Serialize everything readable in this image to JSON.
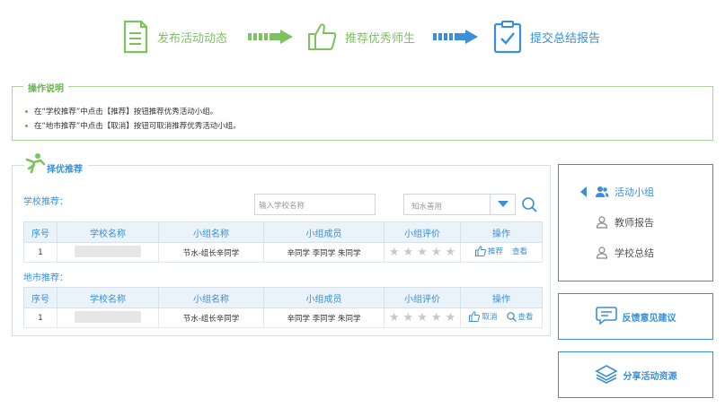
{
  "steps": [
    {
      "label": "发布活动动态",
      "icon": "document-icon"
    },
    {
      "label": "推荐优秀师生",
      "icon": "thumbs-up-icon"
    },
    {
      "label": "提交总结报告",
      "icon": "clipboard-check-icon"
    }
  ],
  "instructions": {
    "title": "操作说明",
    "items": [
      "在“学校推荐”中点击【推荐】按钮推荐优秀活动小组。",
      "在“地市推荐”中点击【取消】按钮可取消推荐优秀活动小组。"
    ]
  },
  "panel": {
    "title": "择优推荐",
    "school_section": "学校推荐：",
    "city_section": "地市推荐：",
    "search_placeholder": "输入学校名称",
    "select_value": "知水善用",
    "columns": [
      "序号",
      "学校名称",
      "小组名称",
      "小组成员",
      "小组评价",
      "操作"
    ],
    "school_rows": [
      {
        "index": "1",
        "group": "节水-组长辛同学",
        "members": "辛同学 李同学 朱同学",
        "action1": "推荐",
        "action2": "查看"
      }
    ],
    "city_rows": [
      {
        "index": "1",
        "group": "节水-组长辛同学",
        "members": "辛同学 李同学 朱同学",
        "action1": "取消",
        "action2": "查看"
      }
    ]
  },
  "sidebar": {
    "items": [
      "活动小组",
      "教师报告",
      "学校总结"
    ],
    "feedback": "反馈意见建议",
    "share": "分享活动资源"
  },
  "colors": {
    "green": "#7cc35e",
    "blue": "#3a8fd6"
  }
}
